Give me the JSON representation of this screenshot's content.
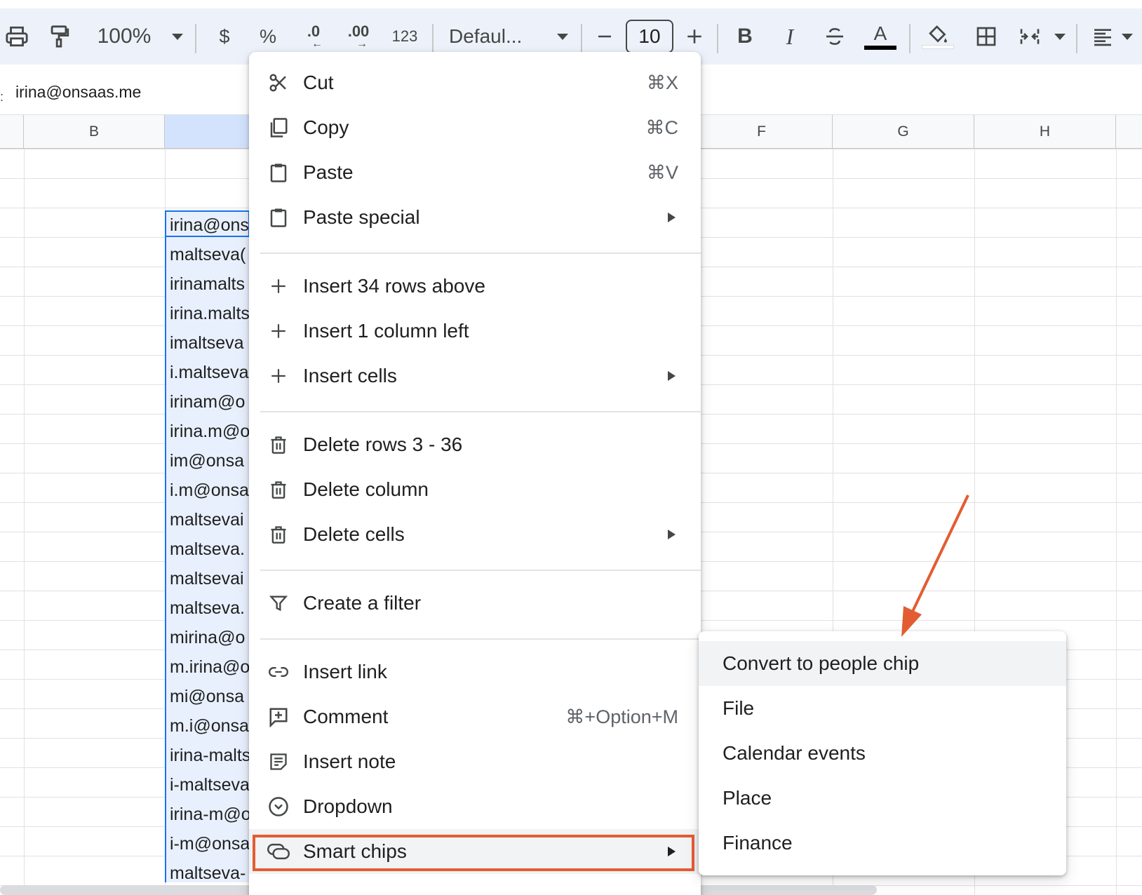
{
  "toolbar": {
    "zoom": "100%",
    "currency": "$",
    "percent": "%",
    "decrease_decimal": ".0",
    "increase_decimal": ".00",
    "number_format": "123",
    "font": "Defaul...",
    "font_size": "10",
    "bold": "B",
    "italic": "I",
    "text_color_letter": "A",
    "text_color_bar": "#000000"
  },
  "formula_bar": {
    "value": "irina@onsaas.me"
  },
  "columns": {
    "b": "B",
    "f": "F",
    "g": "G",
    "h": "H"
  },
  "cells": [
    "irina@ons",
    "maltseva(",
    "irinamalts",
    "irina.malts",
    "imaltseva",
    "i.maltseva",
    "irinam@o",
    "irina.m@o",
    "im@onsa",
    "i.m@onsa",
    "maltsevai",
    "maltseva.",
    "maltsevai",
    "maltseva.",
    "mirina@o",
    "m.irina@o",
    "mi@onsa",
    "m.i@onsa",
    "irina-malts",
    "i-maltseva",
    "irina-m@o",
    "i-m@onsa",
    "maltseva-"
  ],
  "context_menu": {
    "cut": {
      "label": "Cut",
      "shortcut": "⌘X"
    },
    "copy": {
      "label": "Copy",
      "shortcut": "⌘C"
    },
    "paste": {
      "label": "Paste",
      "shortcut": "⌘V"
    },
    "paste_special": {
      "label": "Paste special"
    },
    "insert_rows": {
      "label": "Insert 34 rows above"
    },
    "insert_column": {
      "label": "Insert 1 column left"
    },
    "insert_cells": {
      "label": "Insert cells"
    },
    "delete_rows": {
      "label": "Delete rows 3 - 36"
    },
    "delete_column": {
      "label": "Delete column"
    },
    "delete_cells": {
      "label": "Delete cells"
    },
    "create_filter": {
      "label": "Create a filter"
    },
    "insert_link": {
      "label": "Insert link"
    },
    "comment": {
      "label": "Comment",
      "shortcut": "⌘+Option+M"
    },
    "insert_note": {
      "label": "Insert note"
    },
    "dropdown": {
      "label": "Dropdown"
    },
    "smart_chips": {
      "label": "Smart chips"
    }
  },
  "submenu": {
    "items": [
      "Convert to people chip",
      "File",
      "Calendar events",
      "Place",
      "Finance"
    ]
  },
  "colors": {
    "accent": "#1a73e8",
    "annotation": "#e35d32",
    "toolbar_bg": "#edf2fa",
    "selection_bg": "#e8f0fe"
  }
}
